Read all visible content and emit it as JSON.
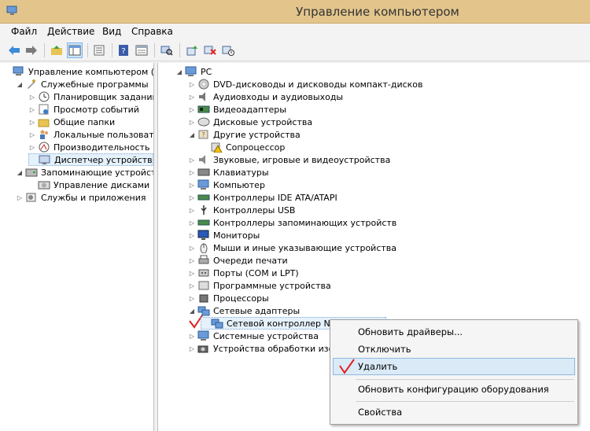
{
  "window": {
    "title": "Управление компьютером"
  },
  "menu": [
    "Файл",
    "Действие",
    "Вид",
    "Справка"
  ],
  "left_tree": [
    {
      "label": "Управление компьютером (ло",
      "level": 0,
      "exp": "",
      "icon": "computer-management-icon"
    },
    {
      "label": "Служебные программы",
      "level": 1,
      "exp": "◢",
      "icon": "tools-icon"
    },
    {
      "label": "Планировщик заданий",
      "level": 2,
      "exp": "▷",
      "icon": "clock-icon"
    },
    {
      "label": "Просмотр событий",
      "level": 2,
      "exp": "▷",
      "icon": "event-viewer-icon"
    },
    {
      "label": "Общие папки",
      "level": 2,
      "exp": "▷",
      "icon": "shared-folder-icon"
    },
    {
      "label": "Локальные пользовате",
      "level": 2,
      "exp": "▷",
      "icon": "users-icon"
    },
    {
      "label": "Производительность",
      "level": 2,
      "exp": "▷",
      "icon": "performance-icon"
    },
    {
      "label": "Диспетчер устройств",
      "level": 2,
      "exp": "",
      "icon": "device-manager-icon",
      "selected": true
    },
    {
      "label": "Запоминающие устройства",
      "level": 1,
      "exp": "◢",
      "icon": "storage-icon"
    },
    {
      "label": "Управление дисками",
      "level": 2,
      "exp": "",
      "icon": "disk-management-icon"
    },
    {
      "label": "Службы и приложения",
      "level": 1,
      "exp": "▷",
      "icon": "services-icon"
    }
  ],
  "right_tree": [
    {
      "label": "PC",
      "level": 0,
      "exp": "◢",
      "icon": "pc-icon"
    },
    {
      "label": "DVD-дисководы и дисководы компакт-дисков",
      "level": 1,
      "exp": "▷",
      "icon": "dvd-icon"
    },
    {
      "label": "Аудиовходы и аудиовыходы",
      "level": 1,
      "exp": "▷",
      "icon": "audio-icon"
    },
    {
      "label": "Видеоадаптеры",
      "level": 1,
      "exp": "▷",
      "icon": "display-adapter-icon"
    },
    {
      "label": "Дисковые устройства",
      "level": 1,
      "exp": "▷",
      "icon": "disk-drive-icon"
    },
    {
      "label": "Другие устройства",
      "level": 1,
      "exp": "◢",
      "icon": "other-devices-icon"
    },
    {
      "label": "Сопроцессор",
      "level": 2,
      "exp": "",
      "icon": "warning-icon"
    },
    {
      "label": "Звуковые, игровые и видеоустройства",
      "level": 1,
      "exp": "▷",
      "icon": "sound-icon"
    },
    {
      "label": "Клавиатуры",
      "level": 1,
      "exp": "▷",
      "icon": "keyboard-icon"
    },
    {
      "label": "Компьютер",
      "level": 1,
      "exp": "▷",
      "icon": "computer-icon"
    },
    {
      "label": "Контроллеры IDE ATA/ATAPI",
      "level": 1,
      "exp": "▷",
      "icon": "ide-icon"
    },
    {
      "label": "Контроллеры USB",
      "level": 1,
      "exp": "▷",
      "icon": "usb-icon"
    },
    {
      "label": "Контроллеры запоминающих устройств",
      "level": 1,
      "exp": "▷",
      "icon": "storage-controller-icon"
    },
    {
      "label": "Мониторы",
      "level": 1,
      "exp": "▷",
      "icon": "monitor-icon"
    },
    {
      "label": "Мыши и иные указывающие устройства",
      "level": 1,
      "exp": "▷",
      "icon": "mouse-icon"
    },
    {
      "label": "Очереди печати",
      "level": 1,
      "exp": "▷",
      "icon": "printer-icon"
    },
    {
      "label": "Порты (COM и LPT)",
      "level": 1,
      "exp": "▷",
      "icon": "port-icon"
    },
    {
      "label": "Программные устройства",
      "level": 1,
      "exp": "▷",
      "icon": "software-device-icon"
    },
    {
      "label": "Процессоры",
      "level": 1,
      "exp": "▷",
      "icon": "processor-icon"
    },
    {
      "label": "Сетевые адаптеры",
      "level": 1,
      "exp": "◢",
      "icon": "network-adapter-icon"
    },
    {
      "label": "Сетевой контроллер NVIDIA nForce",
      "level": 2,
      "exp": "",
      "icon": "network-card-icon",
      "selected": true
    },
    {
      "label": "Системные устройства",
      "level": 1,
      "exp": "▷",
      "icon": "system-devices-icon"
    },
    {
      "label": "Устройства обработки изображений",
      "level": 1,
      "exp": "▷",
      "icon": "imaging-icon"
    }
  ],
  "context_menu": {
    "items": [
      "Обновить драйверы...",
      "Отключить",
      "Удалить",
      "Обновить конфигурацию оборудования",
      "Свойства"
    ],
    "highlighted": "Удалить"
  },
  "colors": {
    "titlebar": "#e3c58c",
    "highlight": "#dbeaf7",
    "check": "#e02020"
  }
}
